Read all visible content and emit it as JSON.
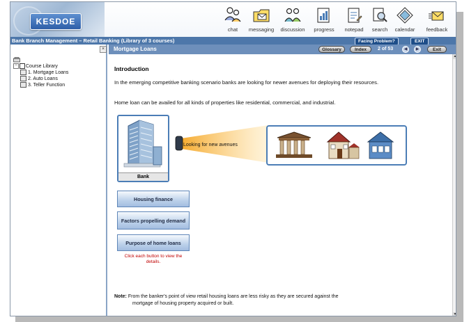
{
  "app": {
    "logo_text": "KESDOE",
    "brand_color": "#4d77aa"
  },
  "toolbar": {
    "items": [
      {
        "label": "chat",
        "icon": "chat-people-icon"
      },
      {
        "label": "messaging",
        "icon": "folder-envelope-icon"
      },
      {
        "label": "discussion",
        "icon": "discussion-people-icon"
      },
      {
        "label": "progress",
        "icon": "progress-report-icon"
      },
      {
        "label": "notepad",
        "icon": "notepad-icon"
      },
      {
        "label": "search",
        "icon": "search-icon"
      },
      {
        "label": "calendar",
        "icon": "calendar-icon"
      },
      {
        "label": "feedback",
        "icon": "feedback-icon"
      }
    ]
  },
  "titlebar": {
    "course_title": "Bank Branch Management – Retail Banking (Library of 3 courses)",
    "facing_problem": "Facing Problem?",
    "exit": "EXIT"
  },
  "sidebar": {
    "close": "×",
    "root": "Course Library",
    "items": [
      {
        "label": "1. Mortgage Loans"
      },
      {
        "label": "2. Auto Loans"
      },
      {
        "label": "3. Teller Function"
      }
    ]
  },
  "content_bar": {
    "title": "Mortgage Loans",
    "glossary": "Glossary",
    "index": "Index",
    "page": "2 of 53",
    "exit": "Exit"
  },
  "content": {
    "heading": "Introduction",
    "para1": "In the emerging competitive banking scenario banks are looking for newer avenues for deploying their resources.",
    "para2": "Home loan can be availed for all kinds of properties like residential, commercial, and industrial.",
    "bank_label": "Bank",
    "beam_text": "Looking for new avenues",
    "buttons": [
      {
        "label": "Housing finance"
      },
      {
        "label": "Factors propelling demand"
      },
      {
        "label": "Purpose of home loans"
      }
    ],
    "hint": "Click each button to view the details.",
    "note_label": "Note:",
    "note_line1": "From the banker's point of view retail housing loans are less risky as they are secured against the",
    "note_line2": "mortgage of housing property acquired or built."
  }
}
